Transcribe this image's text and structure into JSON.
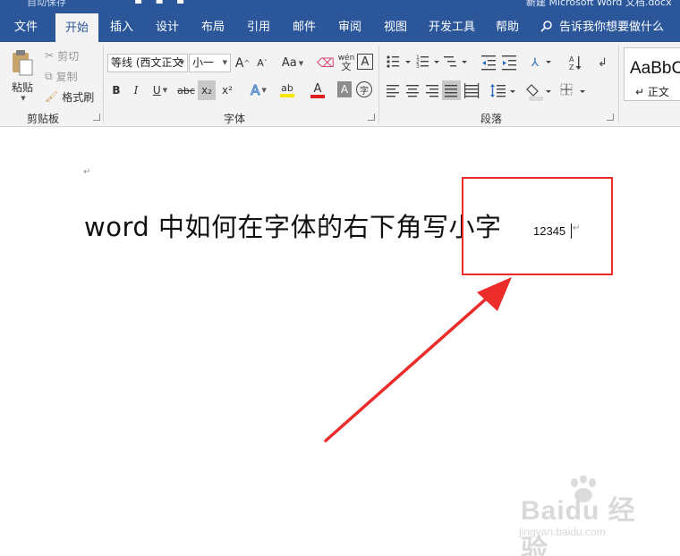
{
  "app": {
    "qat_text": "自动保存",
    "title": "新建 Microsoft Word 文档.docx"
  },
  "tabs": [
    {
      "label": "文件"
    },
    {
      "label": "开始"
    },
    {
      "label": "插入"
    },
    {
      "label": "设计"
    },
    {
      "label": "布局"
    },
    {
      "label": "引用"
    },
    {
      "label": "邮件"
    },
    {
      "label": "审阅"
    },
    {
      "label": "视图"
    },
    {
      "label": "开发工具"
    },
    {
      "label": "帮助"
    }
  ],
  "active_tab": "开始",
  "tell_me": "告诉我你想要做什么",
  "clipboard": {
    "paste": "粘贴",
    "cut": "剪切",
    "copy": "复制",
    "format_painter": "格式刷",
    "group_label": "剪贴板"
  },
  "font": {
    "font_name": "等线 (西文正文",
    "font_size": "小一",
    "grow_glyph": "A",
    "shrink_glyph": "A",
    "change_case": "Aa",
    "phonetic_glyph": "wén",
    "border_glyph": "A",
    "bold": "B",
    "italic": "I",
    "underline": "U",
    "strikethrough": "abc",
    "subscript": "x₂",
    "superscript": "x²",
    "effects_glyph": "A",
    "highlight_glyph": "ab",
    "font_color_glyph": "A",
    "shading_glyph": "A",
    "enclose_glyph": "字",
    "group_label": "字体",
    "highlight_color": "#f5e600",
    "font_color": "#e0201c"
  },
  "paragraph": {
    "group_label": "段落"
  },
  "styles": {
    "sample": "AaBbC",
    "name": "↵ 正文"
  },
  "document": {
    "para_mark": "↵",
    "headline": "word 中如何在字体的右下角写小字",
    "subscript_text": "12345",
    "cursor_mark": "↵"
  },
  "annotation": {
    "box_color": "#ec2b2b"
  },
  "watermark": {
    "brand": "Baidu 经验",
    "url": "jingyan.baidu.com"
  }
}
